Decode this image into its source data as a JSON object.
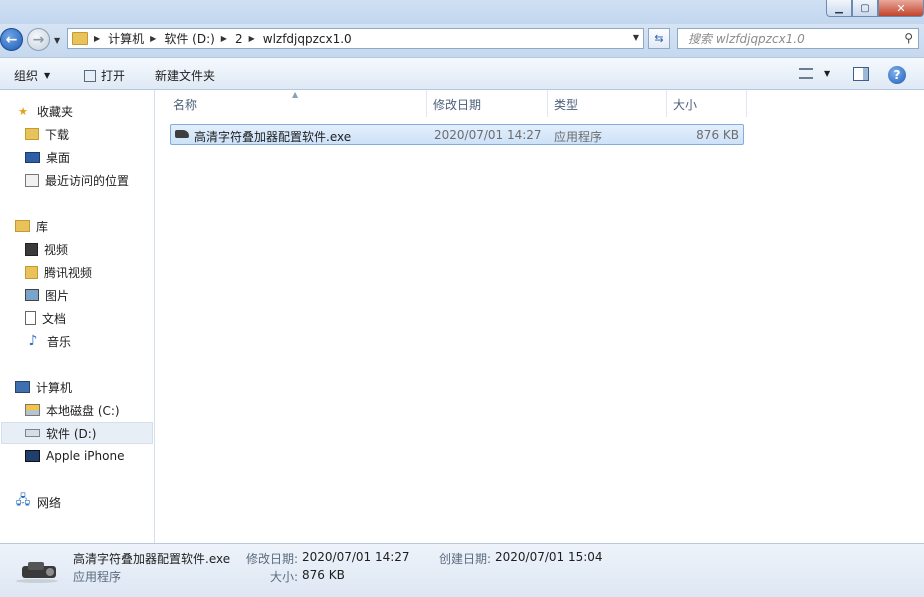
{
  "window": {
    "minimize_icon": "minimize-icon",
    "maximize_icon": "maximize-icon",
    "close_icon": "close-icon"
  },
  "address": {
    "breadcrumbs": [
      "计算机",
      "软件 (D:)",
      "2",
      "wlzfdjqpzcx1.0"
    ]
  },
  "search": {
    "placeholder": "搜索 wlzfdjqpzcx1.0"
  },
  "toolbar": {
    "organize": "组织",
    "open": "打开",
    "new_folder": "新建文件夹"
  },
  "sidebar": {
    "favorites": "收藏夹",
    "downloads": "下载",
    "desktop": "桌面",
    "recent": "最近访问的位置",
    "libraries": "库",
    "videos": "视频",
    "tencent_video": "腾讯视频",
    "pictures": "图片",
    "documents": "文档",
    "music": "音乐",
    "computer": "计算机",
    "local_disk": "本地磁盘 (C:)",
    "software_disk": "软件 (D:)",
    "iphone": "Apple iPhone",
    "network": "网络"
  },
  "columns": {
    "name": "名称",
    "modified": "修改日期",
    "type": "类型",
    "size": "大小"
  },
  "files": [
    {
      "name": "高清字符叠加器配置软件.exe",
      "modified": "2020/07/01 14:27",
      "type": "应用程序",
      "size": "876 KB"
    }
  ],
  "details": {
    "filename": "高清字符叠加器配置软件.exe",
    "filetype": "应用程序",
    "modified_label": "修改日期:",
    "modified_value": "2020/07/01 14:27",
    "created_label": "创建日期:",
    "created_value": "2020/07/01 15:04",
    "size_label": "大小:",
    "size_value": "876 KB"
  },
  "colors": {
    "selection_fill": "#cde2f8",
    "selection_border": "#84acdd",
    "chrome": "#dbe6f3"
  }
}
